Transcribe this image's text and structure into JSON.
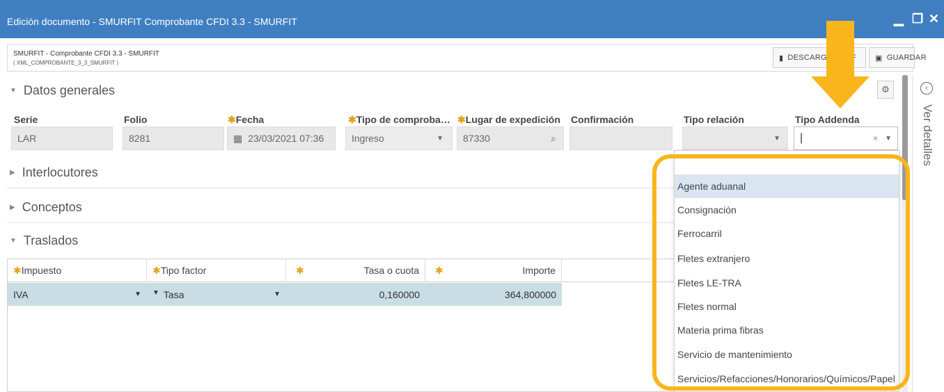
{
  "window": {
    "title": "Edición documento - SMURFIT Comprobante CFDI 3.3 - SMURFIT"
  },
  "doc": {
    "name": "SMURFIT - Comprobante CFDI 3.3 - SMURFIT",
    "code": "( XML_COMPROBANTE_3_3_SMURFIT )",
    "descargar_label": "DESCARGAR PDF",
    "guardar_label": "GUARDAR"
  },
  "sections": {
    "datos_generales": "Datos generales",
    "interlocutores": "Interlocutores",
    "conceptos": "Conceptos",
    "traslados": "Traslados"
  },
  "fields": {
    "serie": {
      "label": "Serie",
      "value": "LAR"
    },
    "folio": {
      "label": "Folio",
      "value": "8281"
    },
    "fecha": {
      "label": "Fecha",
      "value": "23/03/2021 07:36"
    },
    "tipo_comprobante": {
      "label": "Tipo de comproba…",
      "value": "Ingreso"
    },
    "lugar": {
      "label": "Lugar de expedición",
      "value": "87330"
    },
    "confirmacion": {
      "label": "Confirmación",
      "value": ""
    },
    "tipo_relacion": {
      "label": "Tipo relación",
      "value": ""
    },
    "tipo_addenda": {
      "label": "Tipo Addenda",
      "value": ""
    }
  },
  "sidepanel": {
    "label": "Ver detalles"
  },
  "traslados_table": {
    "headers": [
      "Impuesto",
      "Tipo factor",
      "",
      "Tasa o cuota",
      "",
      "Importe"
    ],
    "row": {
      "impuesto": "IVA",
      "tipo_factor": "Tasa",
      "tasa": "0,160000",
      "importe": "364,800000"
    }
  },
  "addenda_options": [
    "Agente aduanal",
    "Consignación",
    "Ferrocarril",
    "Fletes extranjero",
    "Fletes LE-TRA",
    "Fletes normal",
    "Materia prima fibras",
    "Servicio de mantenimiento",
    "Servicios/Refacciones/Honorarios/Químicos/Papel"
  ],
  "colors": {
    "titlebar": "#3f7fc1",
    "highlight": "#f9b51c",
    "required": "#e6a11a",
    "row_selected": "#c9dde4"
  }
}
